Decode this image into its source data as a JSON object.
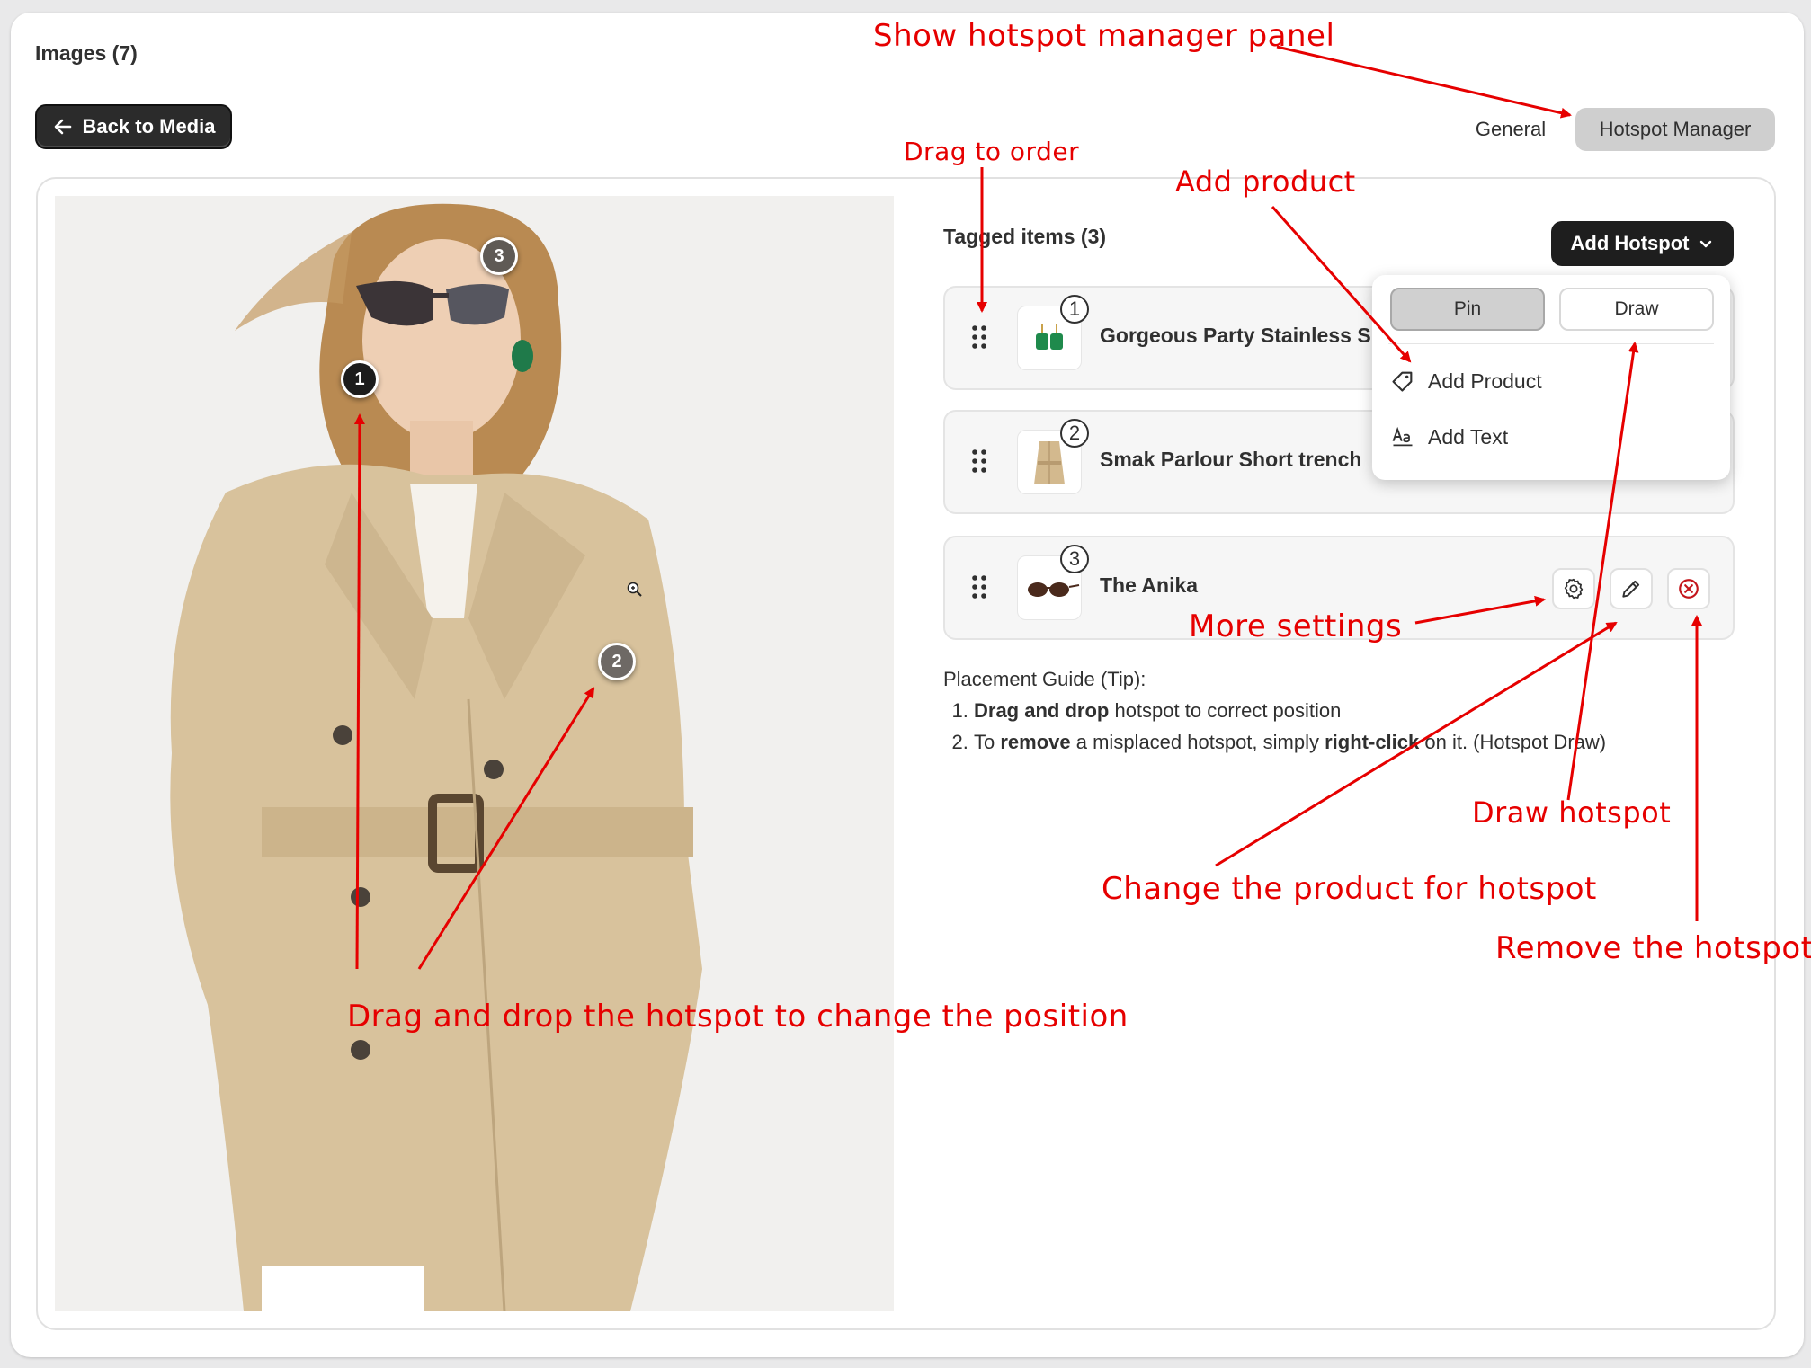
{
  "header": {
    "title": "Images (7)"
  },
  "toolbar": {
    "back_label": "Back to Media",
    "tabs": [
      {
        "label": "General",
        "selected": false
      },
      {
        "label": "Hotspot Manager",
        "selected": true
      }
    ]
  },
  "tagged": {
    "title": "Tagged items (3)",
    "add_hotspot_label": "Add Hotspot",
    "items": [
      {
        "number": "1",
        "name": "Gorgeous Party Stainless S"
      },
      {
        "number": "2",
        "name": "Smak Parlour Short trench"
      },
      {
        "number": "3",
        "name": "The Anika"
      }
    ]
  },
  "dropdown": {
    "pin_label": "Pin",
    "draw_label": "Draw",
    "items": [
      {
        "label": "Add Product",
        "icon": "tag-icon"
      },
      {
        "label": "Add Text",
        "icon": "text-format-icon"
      }
    ]
  },
  "hotspots": [
    "1",
    "2",
    "3"
  ],
  "guide": {
    "title": "Placement Guide (Tip):",
    "step1_bold": "Drag and drop",
    "step1_rest": " hotspot to correct position",
    "step2_pre": "To ",
    "step2_bold1": "remove",
    "step2_mid": " a misplaced hotspot, simply ",
    "step2_bold2": "right-click",
    "step2_post": " on it. (Hotspot Draw)"
  },
  "annotations": {
    "show_panel": "Show hotspot manager panel",
    "drag_order": "Drag to order",
    "add_product": "Add product",
    "more_settings": "More settings",
    "draw_hotspot": "Draw hotspot",
    "change_product": "Change the product for hotspot",
    "remove_hotspot": "Remove the hotspot",
    "drag_drop": "Drag and drop the hotspot to change the position"
  },
  "colors": {
    "annotation": "#e60000",
    "primary_button": "#1e1e1e",
    "selected_tab": "#cfcfcf",
    "remove_icon": "#c4161c",
    "coat": "#d8c29c"
  }
}
